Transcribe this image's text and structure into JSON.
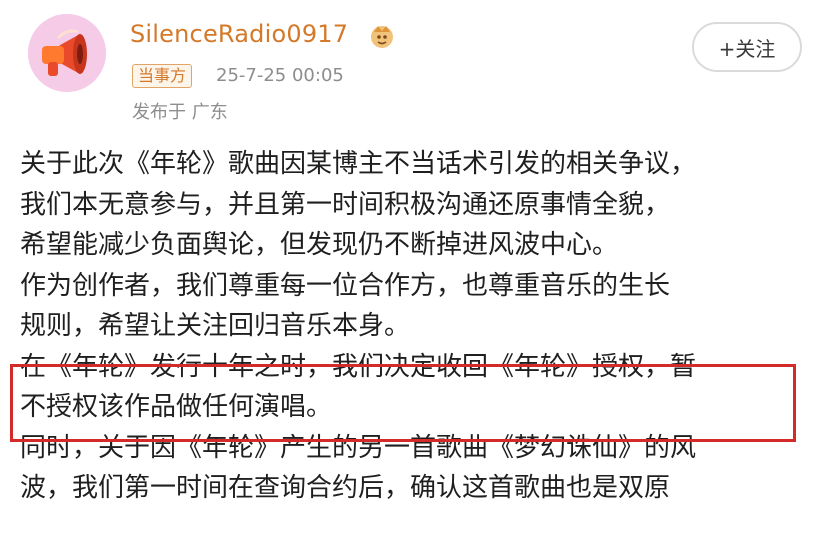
{
  "author": {
    "username": "SilenceRadio0917",
    "avatar_icon": "megaphone-icon",
    "verified_icon": "badge-icon",
    "role_tag": "当事方",
    "timestamp": "25-7-25 00:05",
    "location": "发布于 广东"
  },
  "follow_button": {
    "label": "+关注"
  },
  "post": {
    "lines": [
      "关于此次《年轮》歌曲因某博主不当话术引发的相关争议，",
      "我们本无意参与，并且第一时间积极沟通还原事情全貌，",
      "希望能减少负面舆论，但发现仍不断掉进风波中心。",
      "作为创作者，我们尊重每一位合作方，也尊重音乐的生长",
      "规则，希望让关注回归音乐本身。",
      "在《年轮》发行十年之时，我们决定收回《年轮》授权，暂",
      "不授权该作品做任何演唱。",
      "同时，关于因《年轮》产生的另一首歌曲《梦幻诛仙》的风",
      "波，我们第一时间在查询合约后，确认这首歌曲也是双原"
    ]
  },
  "colors": {
    "username": "#d4792a",
    "highlight_border": "#d42a2a",
    "meta_text": "#8d8d8d"
  }
}
